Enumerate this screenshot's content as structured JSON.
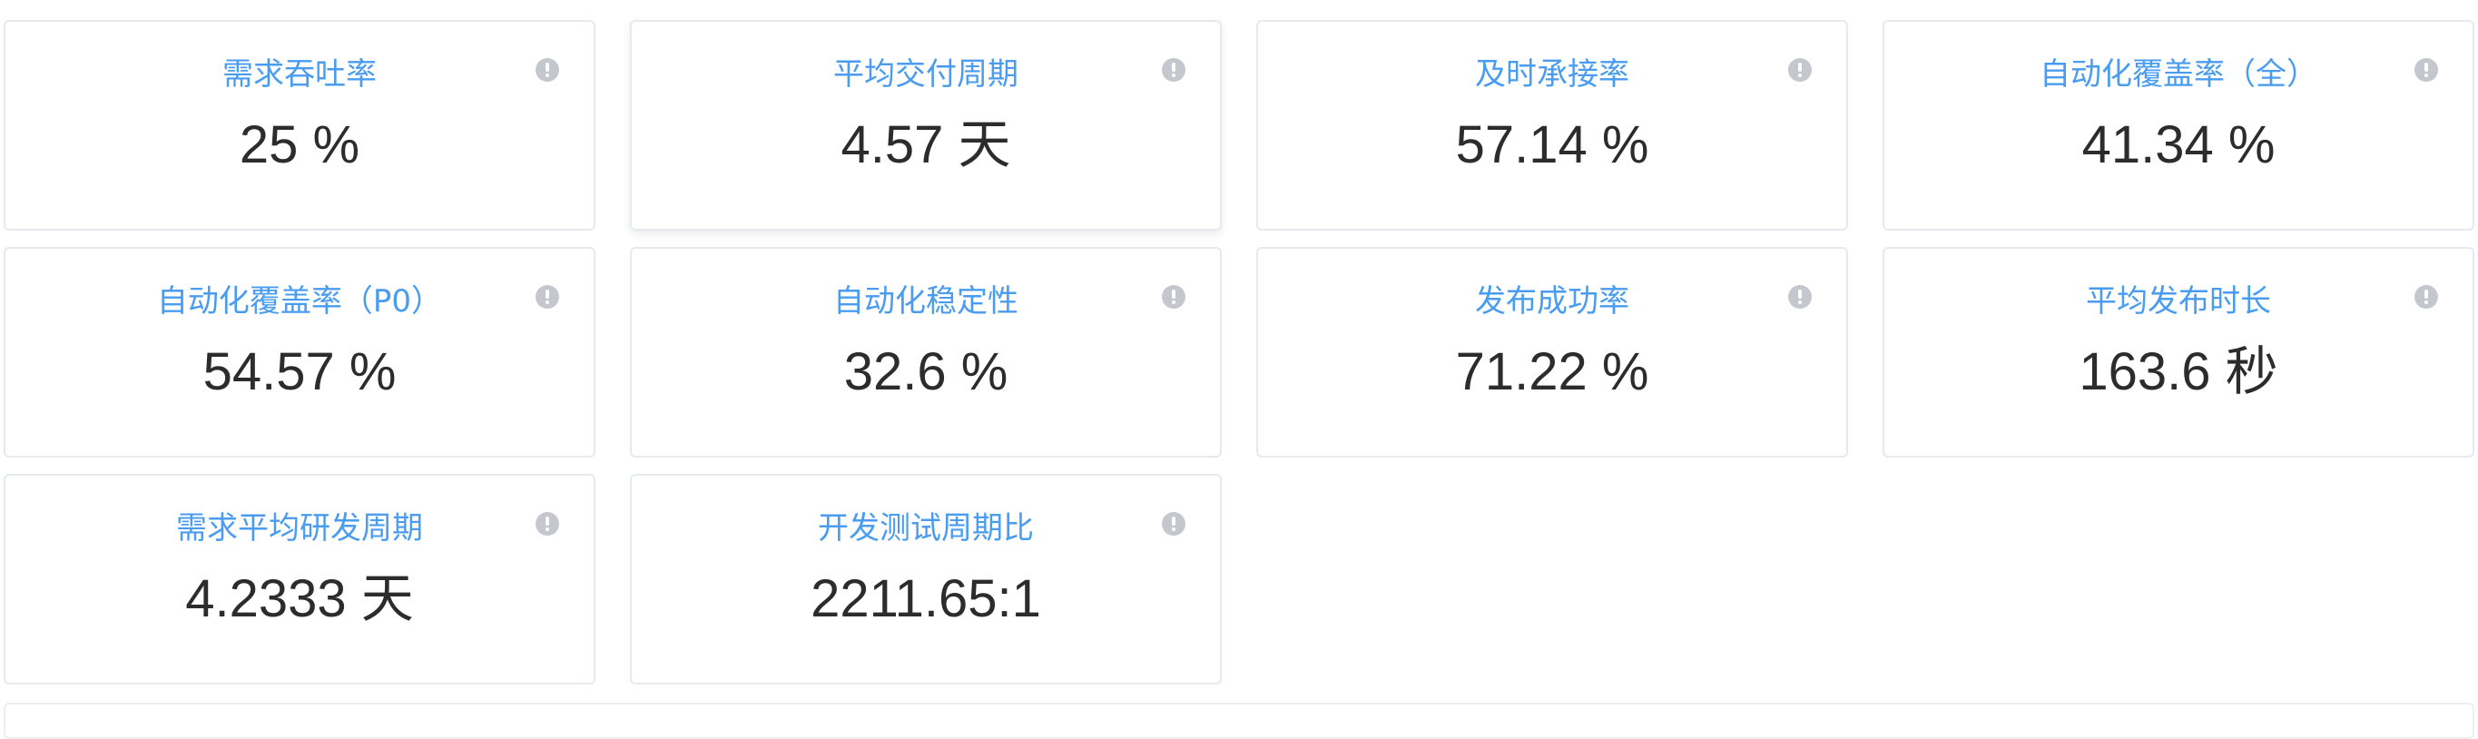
{
  "metrics": [
    {
      "title": "需求吞吐率",
      "value": "25 %",
      "info_icon": "info-circle-icon"
    },
    {
      "title": "平均交付周期",
      "value": "4.57 天",
      "info_icon": "info-circle-icon"
    },
    {
      "title": "及时承接率",
      "value": "57.14 %",
      "info_icon": "info-circle-icon"
    },
    {
      "title": "自动化覆盖率（全）",
      "value": "41.34 %",
      "info_icon": "info-circle-icon"
    },
    {
      "title": "自动化覆盖率（P0）",
      "value": "54.57 %",
      "info_icon": "info-circle-icon"
    },
    {
      "title": "自动化稳定性",
      "value": "32.6 %",
      "info_icon": "info-circle-icon"
    },
    {
      "title": "发布成功率",
      "value": "71.22 %",
      "info_icon": "info-circle-icon"
    },
    {
      "title": "平均发布时长",
      "value": "163.6 秒",
      "info_icon": "info-circle-icon"
    },
    {
      "title": "需求平均研发周期",
      "value": "4.2333 天",
      "info_icon": "info-circle-icon"
    },
    {
      "title": "开发测试周期比",
      "value": "2211.65:1",
      "info_icon": "info-circle-icon"
    }
  ],
  "colors": {
    "title": "#4a9cf0",
    "value": "#2c2c2c",
    "border": "#e6e9ee",
    "info_icon": "#c4c8ce"
  }
}
